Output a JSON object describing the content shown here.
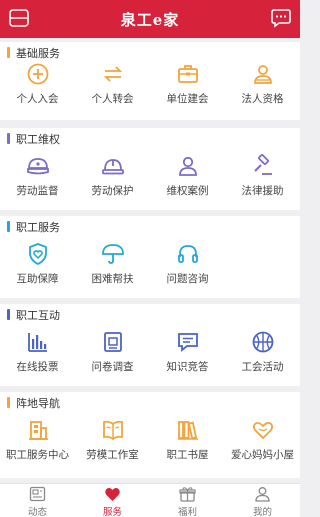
{
  "header": {
    "title": "泉工e家",
    "menu_icon": "menu-icon",
    "message_icon": "chat-bubble-icon"
  },
  "sections": [
    {
      "title": "基础服务",
      "accent": "#f3a43c",
      "items": [
        {
          "label": "个人入会",
          "icon": "plus-circle-icon",
          "color": "#f3a43c"
        },
        {
          "label": "个人转会",
          "icon": "transfer-arrows-icon",
          "color": "#f3a43c"
        },
        {
          "label": "单位建会",
          "icon": "briefcase-icon",
          "color": "#f3a43c"
        },
        {
          "label": "法人资格",
          "icon": "user-group-icon",
          "color": "#f3a43c"
        }
      ]
    },
    {
      "title": "职工维权",
      "accent": "#7c6cc6",
      "items": [
        {
          "label": "劳动监督",
          "icon": "cap-icon",
          "color": "#7c6cc6"
        },
        {
          "label": "劳动保护",
          "icon": "helmet-icon",
          "color": "#7c6cc6"
        },
        {
          "label": "维权案例",
          "icon": "person-icon",
          "color": "#7c6cc6"
        },
        {
          "label": "法律援助",
          "icon": "gavel-icon",
          "color": "#7c6cc6"
        }
      ]
    },
    {
      "title": "职工服务",
      "accent": "#23a7d6",
      "items": [
        {
          "label": "互助保障",
          "icon": "shield-heart-icon",
          "color": "#23a7d6"
        },
        {
          "label": "困难帮扶",
          "icon": "umbrella-icon",
          "color": "#23a7d6"
        },
        {
          "label": "问题咨询",
          "icon": "headphones-icon",
          "color": "#23a7d6"
        }
      ]
    },
    {
      "title": "职工互动",
      "accent": "#4a63c6",
      "items": [
        {
          "label": "在线投票",
          "icon": "bar-chart-icon",
          "color": "#4a63c6"
        },
        {
          "label": "问卷调查",
          "icon": "questionnaire-icon",
          "color": "#4a63c6"
        },
        {
          "label": "知识竞答",
          "icon": "chat-question-icon",
          "color": "#4a63c6"
        },
        {
          "label": "工会活动",
          "icon": "basketball-icon",
          "color": "#4a63c6"
        }
      ]
    },
    {
      "title": "阵地导航",
      "accent": "#f3a43c",
      "items": [
        {
          "label": "职工服务中心",
          "icon": "building-icon",
          "color": "#f3a43c"
        },
        {
          "label": "劳模工作室",
          "icon": "open-book-icon",
          "color": "#f3a43c"
        },
        {
          "label": "职工书屋",
          "icon": "books-icon",
          "color": "#f3a43c"
        },
        {
          "label": "爱心妈妈小屋",
          "icon": "heart-icon",
          "color": "#f3a43c"
        }
      ]
    }
  ],
  "tabbar": {
    "tabs": [
      {
        "label": "动态",
        "icon": "newspaper-icon",
        "active": false
      },
      {
        "label": "服务",
        "icon": "heart-icon",
        "active": true
      },
      {
        "label": "福利",
        "icon": "gift-box-icon",
        "active": false
      },
      {
        "label": "我的",
        "icon": "person-icon",
        "active": false
      }
    ]
  },
  "colors": {
    "brand_red": "#d6223a",
    "inactive_gray": "#888888"
  }
}
